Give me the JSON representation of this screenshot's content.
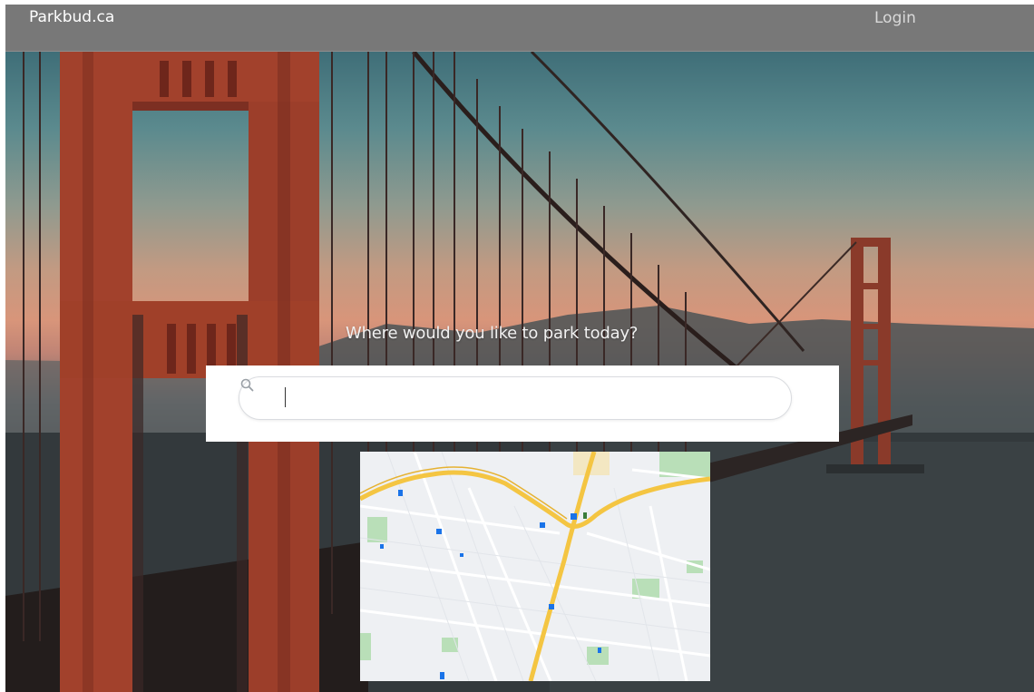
{
  "header": {
    "brand": "Parkbud.ca",
    "login_label": "Login"
  },
  "hero": {
    "tagline": "Where would you like to park today?"
  },
  "search": {
    "value": "",
    "icon": "search-icon"
  },
  "map": {
    "icon": "map-preview"
  },
  "colors": {
    "navbar": "#787878",
    "navbar_text": "#ffffff",
    "bridge": "#b8432c",
    "map_road": "#f4c542",
    "map_park": "#b9dfb8"
  }
}
